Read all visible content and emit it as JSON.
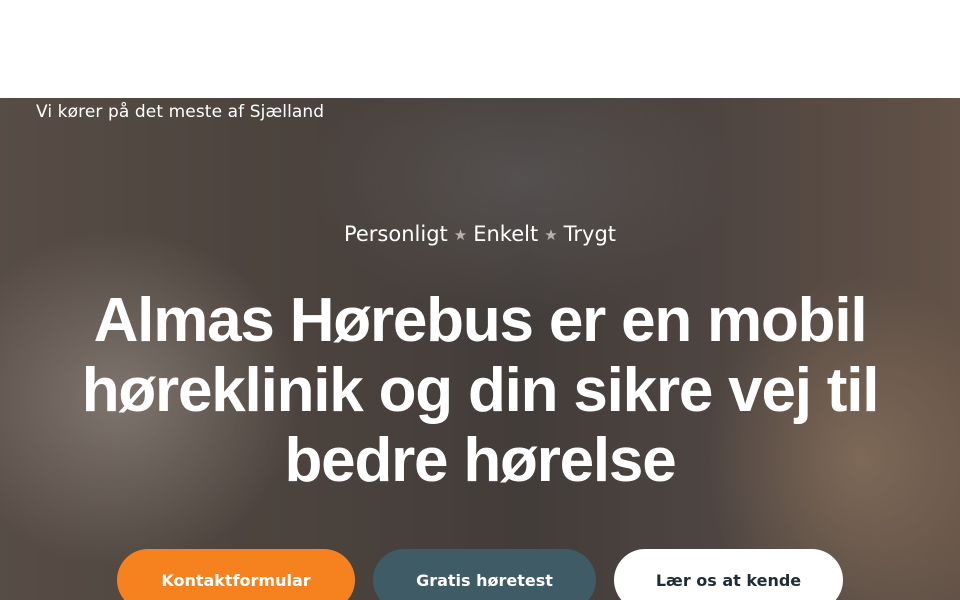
{
  "hero": {
    "region_note": "Vi kører på det meste af Sjælland",
    "tagline": {
      "items": [
        "Personligt",
        "Enkelt",
        "Trygt"
      ],
      "separator_icon": "star-icon"
    },
    "headline_lines": [
      "Almas Hørebus er en mobil",
      "høreklinik og din sikre vej til",
      "bedre hørelse"
    ],
    "buttons": {
      "contact": "Kontaktformular",
      "hearing_test": "Gratis høretest",
      "about": "Lær os at kende"
    }
  },
  "colors": {
    "accent_orange": "#f5821f",
    "slate": "#3f5b66",
    "white": "#ffffff"
  }
}
